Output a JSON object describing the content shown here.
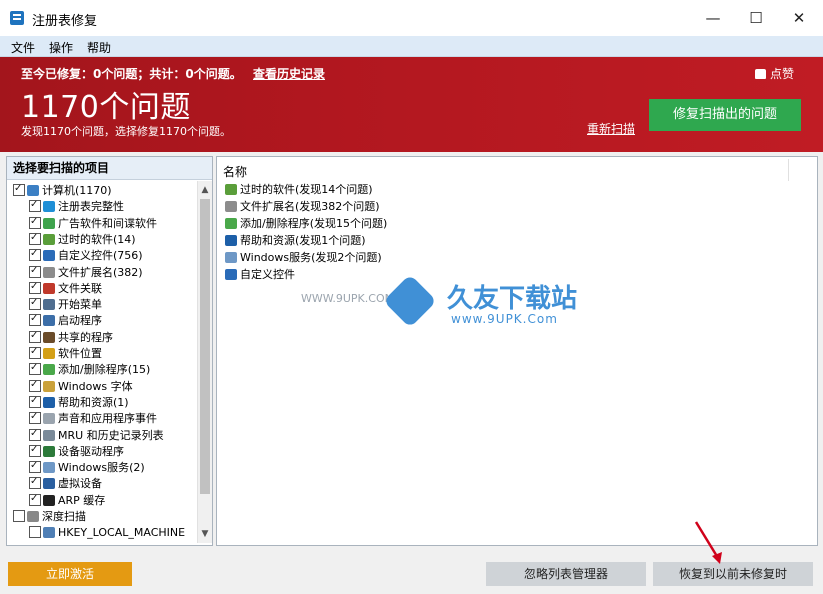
{
  "window": {
    "title": "注册表修复",
    "minimize": "—",
    "maximize": "☐",
    "close": "✕"
  },
  "menu": [
    "文件",
    "操作",
    "帮助"
  ],
  "banner": {
    "summary": "至今已修复：0个问题；共计：0个问题。",
    "history_link": "查看历史记录",
    "like": "点赞",
    "big_title": "1170个问题",
    "found": "发现1170个问题，选择修复1170个问题。",
    "rescan": "重新扫描",
    "fix_button": "修复扫描出的问题"
  },
  "left_panel": {
    "header": "选择要扫描的项目",
    "tree": [
      {
        "label": "计算机(1170)",
        "checked": true,
        "icon_color": "#3b7fc4"
      },
      {
        "label": "注册表完整性",
        "checked": true,
        "icon_color": "#1f8fd6"
      },
      {
        "label": "广告软件和间谍软件",
        "checked": true,
        "icon_color": "#3fa34d"
      },
      {
        "label": "过时的软件(14)",
        "checked": true,
        "icon_color": "#5a9e3a"
      },
      {
        "label": "自定义控件(756)",
        "checked": true,
        "icon_color": "#2a6bb8"
      },
      {
        "label": "文件扩展名(382)",
        "checked": true,
        "icon_color": "#8c8c8c"
      },
      {
        "label": "文件关联",
        "checked": true,
        "icon_color": "#c0392b"
      },
      {
        "label": "开始菜单",
        "checked": true,
        "icon_color": "#4f6d8f"
      },
      {
        "label": "启动程序",
        "checked": true,
        "icon_color": "#3c6ea8"
      },
      {
        "label": "共享的程序",
        "checked": true,
        "icon_color": "#6b4c2a"
      },
      {
        "label": "软件位置",
        "checked": true,
        "icon_color": "#d4a017"
      },
      {
        "label": "添加/删除程序(15)",
        "checked": true,
        "icon_color": "#4aa84a"
      },
      {
        "label": "Windows 字体",
        "checked": true,
        "icon_color": "#caa13a"
      },
      {
        "label": "帮助和资源(1)",
        "checked": true,
        "icon_color": "#1d5fa8"
      },
      {
        "label": "声音和应用程序事件",
        "checked": true,
        "icon_color": "#9aa4ae"
      },
      {
        "label": "MRU 和历史记录列表",
        "checked": true,
        "icon_color": "#7a8a99"
      },
      {
        "label": "设备驱动程序",
        "checked": true,
        "icon_color": "#2c7a3a"
      },
      {
        "label": "Windows服务(2)",
        "checked": true,
        "icon_color": "#6e98c6"
      },
      {
        "label": "虚拟设备",
        "checked": true,
        "icon_color": "#2a5fa0"
      },
      {
        "label": "ARP 缓存",
        "checked": true,
        "icon_color": "#222222"
      },
      {
        "label": "深度扫描",
        "checked": false,
        "icon_color": "#888888"
      },
      {
        "label": "HKEY_LOCAL_MACHINE",
        "checked": false,
        "icon_color": "#4f7fb5"
      }
    ]
  },
  "right_panel": {
    "column": "名称",
    "rows": [
      {
        "label": "过时的软件(发现14个问题)",
        "icon_color": "#5a9e3a"
      },
      {
        "label": "文件扩展名(发现382个问题)",
        "icon_color": "#8c8c8c"
      },
      {
        "label": "添加/删除程序(发现15个问题)",
        "icon_color": "#4aa84a"
      },
      {
        "label": "帮助和资源(发现1个问题)",
        "icon_color": "#1d5fa8"
      },
      {
        "label": "Windows服务(发现2个问题)",
        "icon_color": "#6e98c6"
      },
      {
        "label": "自定义控件",
        "icon_color": "#2a6bb8"
      }
    ]
  },
  "watermark": {
    "url": "WWW.9UPK.COM",
    "title": "久友下载站",
    "sub": "www.9UPK.Com"
  },
  "bottom": {
    "activate": "立即激活",
    "ignore_manager": "忽略列表管理器",
    "restore": "恢复到以前未修复时"
  },
  "colors": {
    "banner_red": "#b1171f",
    "fix_green": "#2fa84f",
    "activate_orange": "#e49a12"
  }
}
